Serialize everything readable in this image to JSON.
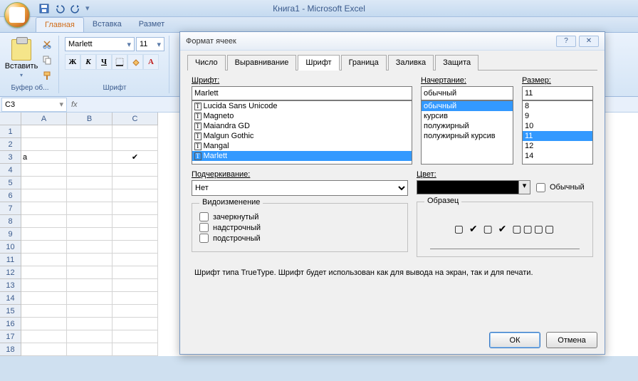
{
  "window": {
    "title": "Книга1  -  Microsoft Excel"
  },
  "ribbon": {
    "tabs": {
      "home": "Главная",
      "insert": "Вставка",
      "layout": "Размет"
    },
    "paste": "Вставить",
    "group_clip": "Буфер об...",
    "group_font": "Шрифт",
    "font_name": "Marlett",
    "font_size": "11",
    "bold": "Ж",
    "italic": "К",
    "underline": "Ч"
  },
  "namebox": "C3",
  "fx": "fx",
  "rows": [
    "1",
    "2",
    "3",
    "4",
    "5",
    "6",
    "7",
    "8",
    "9",
    "10",
    "11",
    "12",
    "13",
    "14",
    "15",
    "16",
    "17",
    "18"
  ],
  "cols": [
    "A",
    "B",
    "C"
  ],
  "cells": {
    "A3": "a",
    "C3": "✔"
  },
  "dialog": {
    "title": "Формат ячеек",
    "tabs": {
      "number": "Число",
      "align": "Выравнивание",
      "font": "Шрифт",
      "border": "Граница",
      "fill": "Заливка",
      "protect": "Защита"
    },
    "labels": {
      "font": "Шрифт:",
      "style": "Начертание:",
      "size": "Размер:",
      "underline": "Подчеркивание:",
      "color": "Цвет:",
      "normal": "Обычный",
      "effects": "Видоизменение",
      "strike": "зачеркнутый",
      "super": "надстрочный",
      "sub": "подстрочный",
      "sample": "Образец"
    },
    "font_value": "Marlett",
    "font_list": [
      "Lucida Sans Unicode",
      "Magneto",
      "Maiandra GD",
      "Malgun Gothic",
      "Mangal",
      "Marlett"
    ],
    "font_selected": "Marlett",
    "style_value": "обычный",
    "style_list": [
      "обычный",
      "курсив",
      "полужирный",
      "полужирный курсив"
    ],
    "style_selected": "обычный",
    "size_value": "11",
    "size_list": [
      "8",
      "9",
      "10",
      "11",
      "12",
      "14"
    ],
    "size_selected": "11",
    "underline_value": "Нет",
    "sample_text": "▢ ✔ ▢ ✔ ▢▢▢▢",
    "hint": "Шрифт типа TrueType. Шрифт будет использован как для вывода на экран, так и для печати.",
    "ok": "ОК",
    "cancel": "Отмена",
    "help": "?",
    "close": "✕"
  }
}
